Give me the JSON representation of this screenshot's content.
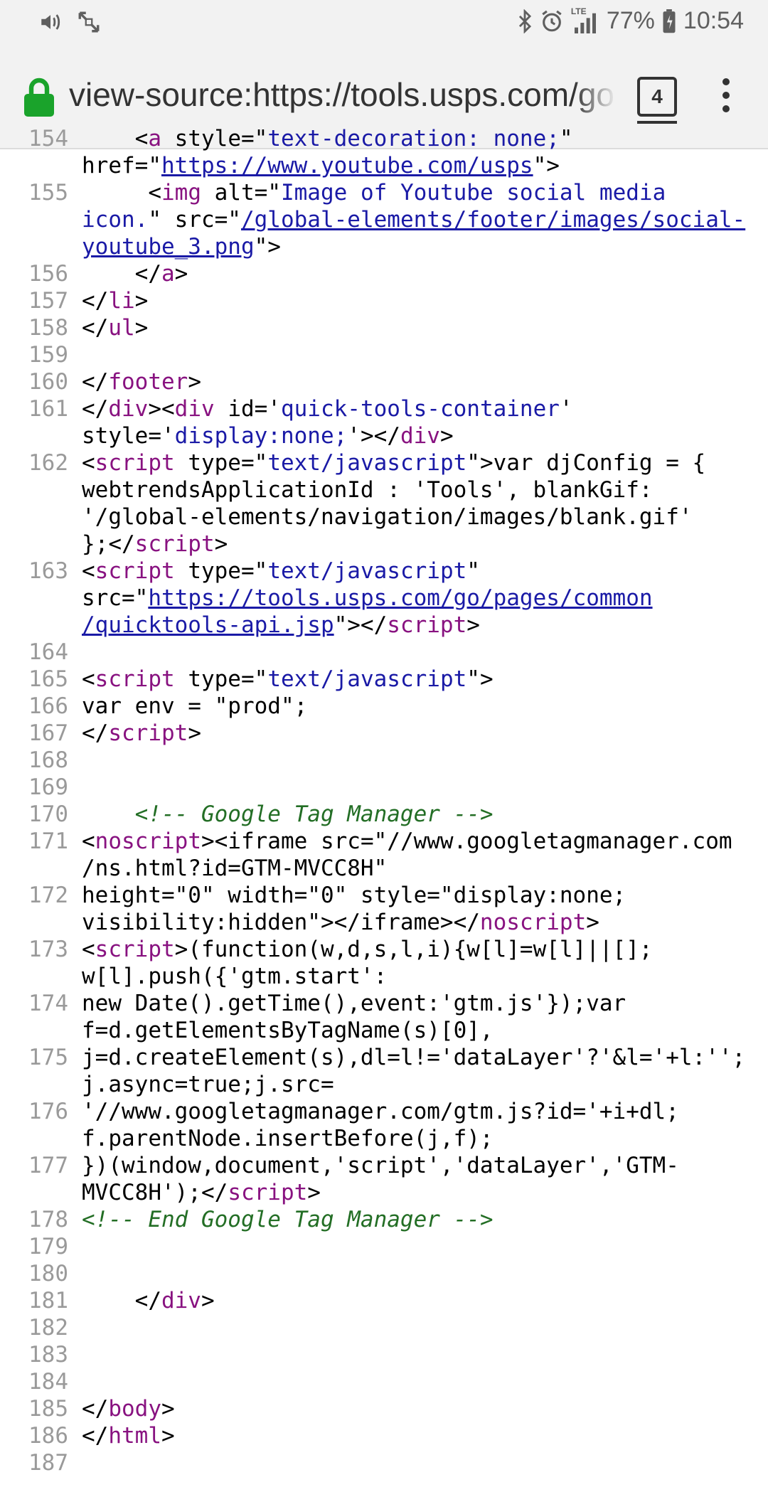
{
  "status_bar": {
    "battery_percent": "77%",
    "time": "10:54",
    "network": "LTE",
    "left_icons": [
      "volume-icon",
      "screen-rotate-icon"
    ],
    "right_icons": [
      "bluetooth-icon",
      "alarm-icon",
      "signal-icon",
      "battery-icon"
    ]
  },
  "url_bar": {
    "url": "view-source:https://tools.usps.com/go",
    "tab_count": "4"
  },
  "colors": {
    "tag": "#881280",
    "attribute_value": "#1a1aa6",
    "comment": "#236e25",
    "line_number": "#9a9a9a",
    "lock_green": "#1aa32b"
  },
  "lines": [
    {
      "n": "154",
      "segs": [
        [
          "p",
          "    <"
        ],
        [
          "t",
          "a"
        ],
        [
          "p",
          " style=\""
        ],
        [
          "v",
          "text-decoration: none;"
        ],
        [
          "p",
          "\"\nhref=\""
        ],
        [
          "l",
          "https://www.youtube.com/usps"
        ],
        [
          "p",
          "\">"
        ]
      ]
    },
    {
      "n": "155",
      "segs": [
        [
          "p",
          "     <"
        ],
        [
          "t",
          "img"
        ],
        [
          "p",
          " alt=\""
        ],
        [
          "v",
          "Image of Youtube social media\nicon."
        ],
        [
          "p",
          "\" src=\""
        ],
        [
          "l",
          "/global-elements/footer/images/social-youtube_3.png"
        ],
        [
          "p",
          "\">"
        ]
      ]
    },
    {
      "n": "156",
      "segs": [
        [
          "p",
          "    </"
        ],
        [
          "t",
          "a"
        ],
        [
          "p",
          ">"
        ]
      ]
    },
    {
      "n": "157",
      "segs": [
        [
          "p",
          "</"
        ],
        [
          "t",
          "li"
        ],
        [
          "p",
          ">"
        ]
      ]
    },
    {
      "n": "158",
      "segs": [
        [
          "p",
          "</"
        ],
        [
          "t",
          "ul"
        ],
        [
          "p",
          ">"
        ]
      ]
    },
    {
      "n": "159",
      "segs": []
    },
    {
      "n": "160",
      "segs": [
        [
          "p",
          "</"
        ],
        [
          "t",
          "footer"
        ],
        [
          "p",
          ">"
        ]
      ]
    },
    {
      "n": "161",
      "segs": [
        [
          "p",
          "</"
        ],
        [
          "t",
          "div"
        ],
        [
          "p",
          "><"
        ],
        [
          "t",
          "div"
        ],
        [
          "p",
          " id='"
        ],
        [
          "v",
          "quick-tools-container"
        ],
        [
          "p",
          "'\nstyle='"
        ],
        [
          "v",
          "display:none;"
        ],
        [
          "p",
          "'></"
        ],
        [
          "t",
          "div"
        ],
        [
          "p",
          ">"
        ]
      ]
    },
    {
      "n": "162",
      "segs": [
        [
          "p",
          "<"
        ],
        [
          "t",
          "script"
        ],
        [
          "p",
          " type=\""
        ],
        [
          "v",
          "text/javascript"
        ],
        [
          "p",
          "\">var djConfig = {\nwebtrendsApplicationId : 'Tools', blankGif:\n'/global-elements/navigation/images/blank.gif'\n};</"
        ],
        [
          "t",
          "script"
        ],
        [
          "p",
          ">"
        ]
      ]
    },
    {
      "n": "163",
      "segs": [
        [
          "p",
          "<"
        ],
        [
          "t",
          "script"
        ],
        [
          "p",
          " type=\""
        ],
        [
          "v",
          "text/javascript"
        ],
        [
          "p",
          "\"\nsrc=\""
        ],
        [
          "l",
          "https://tools.usps.com/go/pages/common\n/quicktools-api.jsp"
        ],
        [
          "p",
          "\"></"
        ],
        [
          "t",
          "script"
        ],
        [
          "p",
          ">"
        ]
      ]
    },
    {
      "n": "164",
      "segs": []
    },
    {
      "n": "165",
      "segs": [
        [
          "p",
          "<"
        ],
        [
          "t",
          "script"
        ],
        [
          "p",
          " type=\""
        ],
        [
          "v",
          "text/javascript"
        ],
        [
          "p",
          "\">"
        ]
      ]
    },
    {
      "n": "166",
      "segs": [
        [
          "p",
          "var env = \"prod\";"
        ]
      ]
    },
    {
      "n": "167",
      "segs": [
        [
          "p",
          "</"
        ],
        [
          "t",
          "script"
        ],
        [
          "p",
          ">"
        ]
      ]
    },
    {
      "n": "168",
      "segs": []
    },
    {
      "n": "169",
      "segs": []
    },
    {
      "n": "170",
      "segs": [
        [
          "c",
          "    <!-- Google Tag Manager -->"
        ]
      ]
    },
    {
      "n": "171",
      "segs": [
        [
          "p",
          "<"
        ],
        [
          "t",
          "noscript"
        ],
        [
          "p",
          "><iframe src=\"//www.googletagmanager.com\n/ns.html?id=GTM-MVCC8H\""
        ]
      ]
    },
    {
      "n": "172",
      "segs": [
        [
          "p",
          "height=\"0\" width=\"0\" style=\"display:none;\nvisibility:hidden\"></iframe></"
        ],
        [
          "t",
          "noscript"
        ],
        [
          "p",
          ">"
        ]
      ]
    },
    {
      "n": "173",
      "segs": [
        [
          "p",
          "<"
        ],
        [
          "t",
          "script"
        ],
        [
          "p",
          ">(function(w,d,s,l,i){w[l]=w[l]||[];\nw[l].push({'gtm.start':"
        ]
      ]
    },
    {
      "n": "174",
      "segs": [
        [
          "p",
          "new Date().getTime(),event:'gtm.js'});var\nf=d.getElementsByTagName(s)[0],"
        ]
      ]
    },
    {
      "n": "175",
      "segs": [
        [
          "p",
          "j=d.createElement(s),dl=l!='dataLayer'?'&l='+l:'';\nj.async=true;j.src="
        ]
      ]
    },
    {
      "n": "176",
      "segs": [
        [
          "p",
          "'//www.googletagmanager.com/gtm.js?id='+i+dl;\nf.parentNode.insertBefore(j,f);"
        ]
      ]
    },
    {
      "n": "177",
      "segs": [
        [
          "p",
          "})(window,document,'script','dataLayer','GTM-\nMVCC8H');</"
        ],
        [
          "t",
          "script"
        ],
        [
          "p",
          ">"
        ]
      ]
    },
    {
      "n": "178",
      "segs": [
        [
          "c",
          "<!-- End Google Tag Manager -->"
        ]
      ]
    },
    {
      "n": "179",
      "segs": []
    },
    {
      "n": "180",
      "segs": []
    },
    {
      "n": "181",
      "segs": [
        [
          "p",
          "    </"
        ],
        [
          "t",
          "div"
        ],
        [
          "p",
          ">"
        ]
      ]
    },
    {
      "n": "182",
      "segs": []
    },
    {
      "n": "183",
      "segs": []
    },
    {
      "n": "184",
      "segs": []
    },
    {
      "n": "185",
      "segs": [
        [
          "p",
          "</"
        ],
        [
          "t",
          "body"
        ],
        [
          "p",
          ">"
        ]
      ]
    },
    {
      "n": "186",
      "segs": [
        [
          "p",
          "</"
        ],
        [
          "t",
          "html"
        ],
        [
          "p",
          ">"
        ]
      ]
    },
    {
      "n": "187",
      "segs": []
    }
  ]
}
